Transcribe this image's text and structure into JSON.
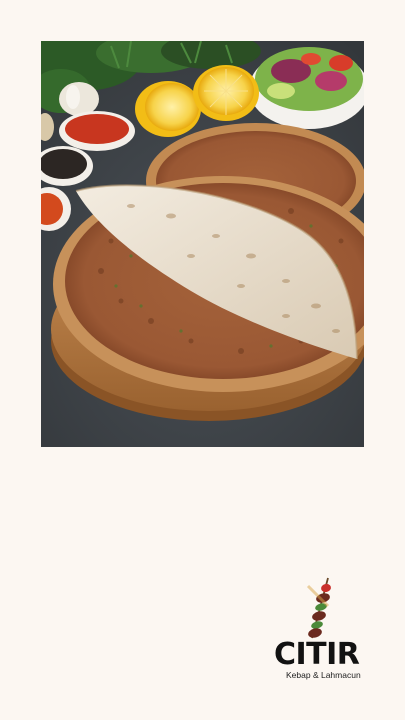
{
  "photo": {
    "subject": "lahmacun-on-wooden-board",
    "colors": {
      "background": "#3f4449",
      "board": "#b57a42",
      "crust": "#c9935a",
      "topping": "#9a5a36",
      "folded_bread": "#ece3d4",
      "lemon": "#f5c22a",
      "greens": "#2f5f2a"
    }
  },
  "brand": {
    "name": "CITIR",
    "tagline": "Kebap & Lahmacun",
    "colors": {
      "text": "#121212",
      "skewer_dark": "#6b2a1f",
      "skewer_green": "#4b8a3a",
      "skewer_red": "#c9302c"
    }
  },
  "page": {
    "background": "#fcf7f2"
  }
}
